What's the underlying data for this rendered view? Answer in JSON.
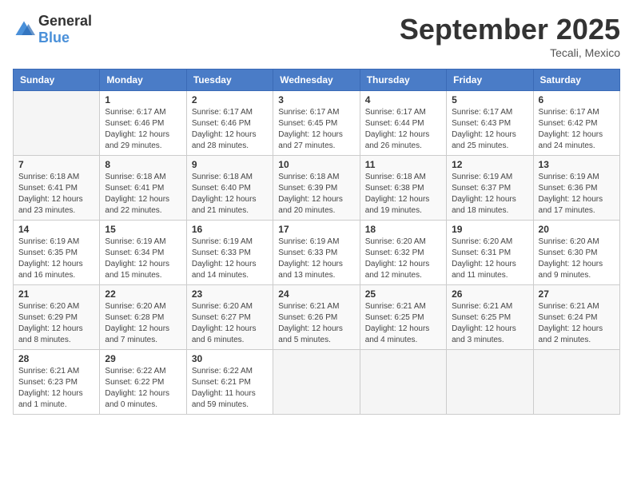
{
  "logo": {
    "general": "General",
    "blue": "Blue"
  },
  "title": {
    "month": "September 2025",
    "location": "Tecali, Mexico"
  },
  "headers": [
    "Sunday",
    "Monday",
    "Tuesday",
    "Wednesday",
    "Thursday",
    "Friday",
    "Saturday"
  ],
  "weeks": [
    [
      {
        "day": "",
        "info": ""
      },
      {
        "day": "1",
        "info": "Sunrise: 6:17 AM\nSunset: 6:46 PM\nDaylight: 12 hours\nand 29 minutes."
      },
      {
        "day": "2",
        "info": "Sunrise: 6:17 AM\nSunset: 6:46 PM\nDaylight: 12 hours\nand 28 minutes."
      },
      {
        "day": "3",
        "info": "Sunrise: 6:17 AM\nSunset: 6:45 PM\nDaylight: 12 hours\nand 27 minutes."
      },
      {
        "day": "4",
        "info": "Sunrise: 6:17 AM\nSunset: 6:44 PM\nDaylight: 12 hours\nand 26 minutes."
      },
      {
        "day": "5",
        "info": "Sunrise: 6:17 AM\nSunset: 6:43 PM\nDaylight: 12 hours\nand 25 minutes."
      },
      {
        "day": "6",
        "info": "Sunrise: 6:17 AM\nSunset: 6:42 PM\nDaylight: 12 hours\nand 24 minutes."
      }
    ],
    [
      {
        "day": "7",
        "info": "Sunrise: 6:18 AM\nSunset: 6:41 PM\nDaylight: 12 hours\nand 23 minutes."
      },
      {
        "day": "8",
        "info": "Sunrise: 6:18 AM\nSunset: 6:41 PM\nDaylight: 12 hours\nand 22 minutes."
      },
      {
        "day": "9",
        "info": "Sunrise: 6:18 AM\nSunset: 6:40 PM\nDaylight: 12 hours\nand 21 minutes."
      },
      {
        "day": "10",
        "info": "Sunrise: 6:18 AM\nSunset: 6:39 PM\nDaylight: 12 hours\nand 20 minutes."
      },
      {
        "day": "11",
        "info": "Sunrise: 6:18 AM\nSunset: 6:38 PM\nDaylight: 12 hours\nand 19 minutes."
      },
      {
        "day": "12",
        "info": "Sunrise: 6:19 AM\nSunset: 6:37 PM\nDaylight: 12 hours\nand 18 minutes."
      },
      {
        "day": "13",
        "info": "Sunrise: 6:19 AM\nSunset: 6:36 PM\nDaylight: 12 hours\nand 17 minutes."
      }
    ],
    [
      {
        "day": "14",
        "info": "Sunrise: 6:19 AM\nSunset: 6:35 PM\nDaylight: 12 hours\nand 16 minutes."
      },
      {
        "day": "15",
        "info": "Sunrise: 6:19 AM\nSunset: 6:34 PM\nDaylight: 12 hours\nand 15 minutes."
      },
      {
        "day": "16",
        "info": "Sunrise: 6:19 AM\nSunset: 6:33 PM\nDaylight: 12 hours\nand 14 minutes."
      },
      {
        "day": "17",
        "info": "Sunrise: 6:19 AM\nSunset: 6:33 PM\nDaylight: 12 hours\nand 13 minutes."
      },
      {
        "day": "18",
        "info": "Sunrise: 6:20 AM\nSunset: 6:32 PM\nDaylight: 12 hours\nand 12 minutes."
      },
      {
        "day": "19",
        "info": "Sunrise: 6:20 AM\nSunset: 6:31 PM\nDaylight: 12 hours\nand 11 minutes."
      },
      {
        "day": "20",
        "info": "Sunrise: 6:20 AM\nSunset: 6:30 PM\nDaylight: 12 hours\nand 9 minutes."
      }
    ],
    [
      {
        "day": "21",
        "info": "Sunrise: 6:20 AM\nSunset: 6:29 PM\nDaylight: 12 hours\nand 8 minutes."
      },
      {
        "day": "22",
        "info": "Sunrise: 6:20 AM\nSunset: 6:28 PM\nDaylight: 12 hours\nand 7 minutes."
      },
      {
        "day": "23",
        "info": "Sunrise: 6:20 AM\nSunset: 6:27 PM\nDaylight: 12 hours\nand 6 minutes."
      },
      {
        "day": "24",
        "info": "Sunrise: 6:21 AM\nSunset: 6:26 PM\nDaylight: 12 hours\nand 5 minutes."
      },
      {
        "day": "25",
        "info": "Sunrise: 6:21 AM\nSunset: 6:25 PM\nDaylight: 12 hours\nand 4 minutes."
      },
      {
        "day": "26",
        "info": "Sunrise: 6:21 AM\nSunset: 6:25 PM\nDaylight: 12 hours\nand 3 minutes."
      },
      {
        "day": "27",
        "info": "Sunrise: 6:21 AM\nSunset: 6:24 PM\nDaylight: 12 hours\nand 2 minutes."
      }
    ],
    [
      {
        "day": "28",
        "info": "Sunrise: 6:21 AM\nSunset: 6:23 PM\nDaylight: 12 hours\nand 1 minute."
      },
      {
        "day": "29",
        "info": "Sunrise: 6:22 AM\nSunset: 6:22 PM\nDaylight: 12 hours\nand 0 minutes."
      },
      {
        "day": "30",
        "info": "Sunrise: 6:22 AM\nSunset: 6:21 PM\nDaylight: 11 hours\nand 59 minutes."
      },
      {
        "day": "",
        "info": ""
      },
      {
        "day": "",
        "info": ""
      },
      {
        "day": "",
        "info": ""
      },
      {
        "day": "",
        "info": ""
      }
    ]
  ]
}
